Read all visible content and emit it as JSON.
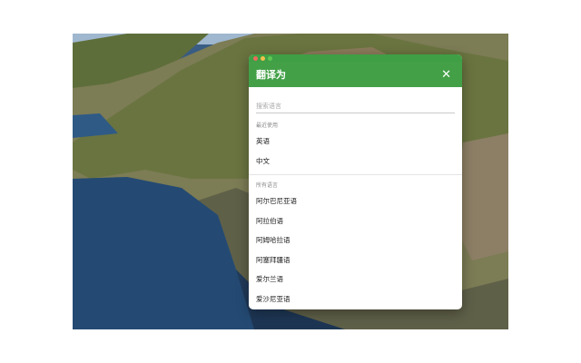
{
  "dialog": {
    "title": "翻译为",
    "close_label": "✕",
    "search_placeholder": "搜索语言",
    "recent": {
      "header": "最近使用",
      "items": [
        "英语",
        "中文"
      ]
    },
    "all": {
      "header": "所有语言",
      "items": [
        "阿尔巴尼亚语",
        "阿拉伯语",
        "阿姆哈拉语",
        "阿塞拜疆语",
        "爱尔兰语",
        "爱沙尼亚语"
      ]
    }
  },
  "colors": {
    "header_green": "#43a047",
    "titlebar_green": "#3f9f45"
  }
}
